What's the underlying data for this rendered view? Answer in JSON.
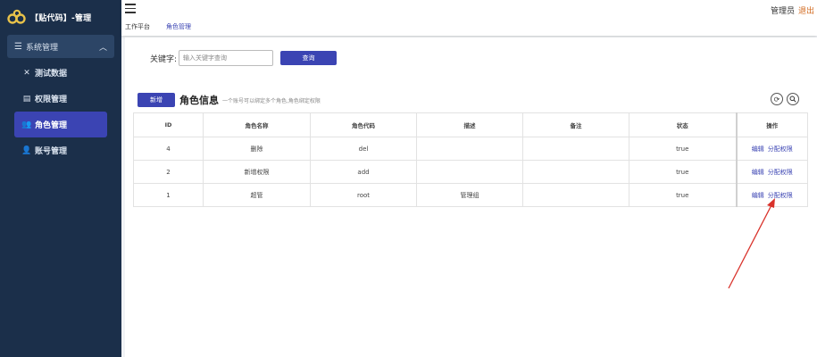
{
  "brand": {
    "title": "【贴代码】-管理"
  },
  "sidebar": {
    "group": {
      "label": "系统管理"
    },
    "items": [
      {
        "label": "测试数据",
        "icon": "close-icon",
        "active": false
      },
      {
        "label": "权限管理",
        "icon": "id-card-icon",
        "active": false
      },
      {
        "label": "角色管理",
        "icon": "users-icon",
        "active": true
      },
      {
        "label": "账号管理",
        "icon": "user-icon",
        "active": false
      }
    ]
  },
  "header": {
    "tabs": [
      {
        "label": "工作平台"
      },
      {
        "label": "角色管理"
      }
    ],
    "user": "管理员",
    "logout": "退出"
  },
  "search": {
    "label": "关键字:",
    "placeholder": "输入关键字查询",
    "button": "查询"
  },
  "section": {
    "add_button": "新增",
    "title": "角色信息",
    "subtitle": "一个账号可以绑定多个角色,角色绑定权限"
  },
  "table": {
    "headers": {
      "id": "ID",
      "name": "角色名称",
      "code": "角色代码",
      "desc": "描述",
      "note": "备注",
      "status": "状态",
      "op": "操作"
    },
    "rows": [
      {
        "id": "4",
        "name": "删除",
        "code": "del",
        "desc": "",
        "note": "",
        "status": "true"
      },
      {
        "id": "2",
        "name": "新增权限",
        "code": "add",
        "desc": "",
        "note": "",
        "status": "true"
      },
      {
        "id": "1",
        "name": "超管",
        "code": "root",
        "desc": "管理组",
        "note": "",
        "status": "true"
      }
    ],
    "ops": {
      "edit": "编辑",
      "assign": "分配权限"
    }
  },
  "colors": {
    "sidebar_bg": "#1b2f4a",
    "accent": "#3b44b3",
    "logout": "#d2691e",
    "arrow": "#d9322b"
  }
}
